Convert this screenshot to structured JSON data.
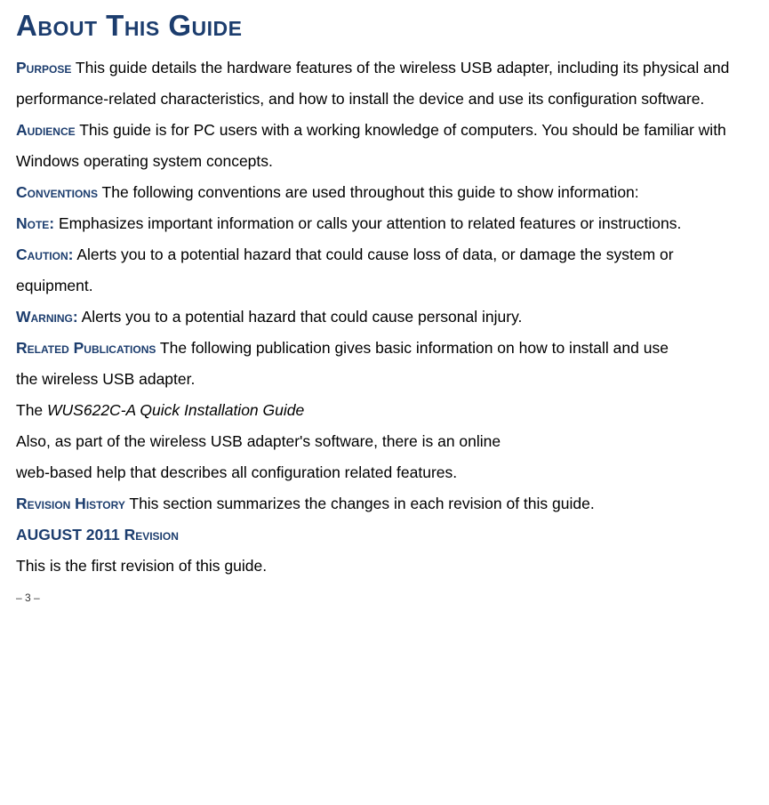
{
  "title": "About This Guide",
  "sections": {
    "purpose": {
      "head": "Purpose",
      "text": " This guide details the hardware features of the wireless USB adapter, including its physical and performance-related characteristics, and how to install the device and use its configuration software."
    },
    "audience": {
      "head": "Audience",
      "text": " This guide is for PC users with a working knowledge of computers. You should be familiar with Windows operating system concepts."
    },
    "conventions": {
      "head": "Conventions",
      "text": " The following conventions are used throughout this guide to show information:"
    },
    "note": {
      "head": "Note:",
      "text": " Emphasizes important information or calls your attention to related features or instructions."
    },
    "caution": {
      "head": "Caution:",
      "text": " Alerts you to a potential hazard that could cause loss of data, or damage the system or equipment."
    },
    "warning": {
      "head": "Warning:",
      "text": " Alerts you to a potential hazard that could cause personal injury."
    },
    "related": {
      "head": "Related Publications",
      "text": " The following publication gives basic information on how to install and use",
      "line2": "the wireless USB adapter.",
      "line3a": "The ",
      "line3b": "WUS622C-A Quick Installation Guide",
      "line4": "Also, as part of the wireless USB adapter's software, there is an online",
      "line5": "web-based help that describes all configuration related features."
    },
    "revision": {
      "head": "Revision History",
      "text": " This section summarizes the changes in each revision of this guide."
    },
    "revdate": {
      "month": "AUGUST 2011 ",
      "word": "Revision",
      "text": "This is the first revision of this guide."
    }
  },
  "page": "– 3 –"
}
